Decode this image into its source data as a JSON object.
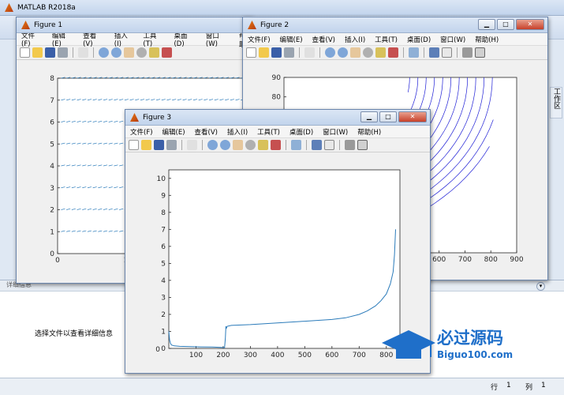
{
  "app": {
    "title": "MATLAB R2018a"
  },
  "bottom_panel": {
    "header": "详细信息",
    "message": "选择文件以查看详细信息",
    "side_label": "工作区"
  },
  "status": {
    "row_label": "行",
    "row_value": "1",
    "col_label": "列",
    "col_value": "1"
  },
  "menu": [
    "文件(F)",
    "编辑(E)",
    "查看(V)",
    "插入(I)",
    "工具(T)",
    "桌面(D)",
    "窗口(W)",
    "帮助(H)"
  ],
  "figure1": {
    "title": "Figure 1",
    "visible_menu_tail": "帮助"
  },
  "figure2": {
    "title": "Figure 2"
  },
  "figure3": {
    "title": "Figure 3"
  },
  "watermark": {
    "brand": "必过源码",
    "url": "Biguo100.com"
  },
  "chart_data": [
    {
      "type": "quiver",
      "figure": "Figure 1",
      "xlim": [
        0,
        30
      ],
      "ylim": [
        0,
        8
      ],
      "xticks": [
        0,
        10,
        20
      ],
      "yticks": [
        0,
        1,
        2,
        3,
        4,
        5,
        6,
        7,
        8
      ],
      "rows_y": [
        1,
        2,
        3,
        4,
        5,
        6,
        7,
        8
      ],
      "color": "#2b7bba"
    },
    {
      "type": "contour",
      "figure": "Figure 2",
      "xlim": [
        0,
        900
      ],
      "ylim": [
        0,
        90
      ],
      "xticks": [
        600,
        700,
        800,
        900
      ],
      "yticks": [
        80,
        90
      ],
      "color": "#1f1fd6"
    },
    {
      "type": "line",
      "figure": "Figure 3",
      "xlim": [
        0,
        850
      ],
      "ylim": [
        0,
        10.5
      ],
      "xticks": [
        100,
        200,
        300,
        400,
        500,
        600,
        700,
        800
      ],
      "yticks": [
        0,
        1,
        2,
        3,
        4,
        5,
        6,
        7,
        8,
        9,
        10
      ],
      "x": [
        0,
        3,
        6,
        10,
        20,
        40,
        80,
        120,
        160,
        200,
        205,
        208,
        210,
        212,
        215,
        230,
        300,
        400,
        500,
        600,
        650,
        700,
        730,
        760,
        780,
        800,
        815,
        825,
        830,
        834
      ],
      "y": [
        1.0,
        0.5,
        0.3,
        0.2,
        0.15,
        0.12,
        0.1,
        0.09,
        0.08,
        0.05,
        0.05,
        0.6,
        1.3,
        1.2,
        1.3,
        1.35,
        1.4,
        1.5,
        1.6,
        1.7,
        1.8,
        2.0,
        2.2,
        2.5,
        2.8,
        3.2,
        3.8,
        4.5,
        5.5,
        7.0
      ],
      "color": "#2b7bba"
    }
  ]
}
